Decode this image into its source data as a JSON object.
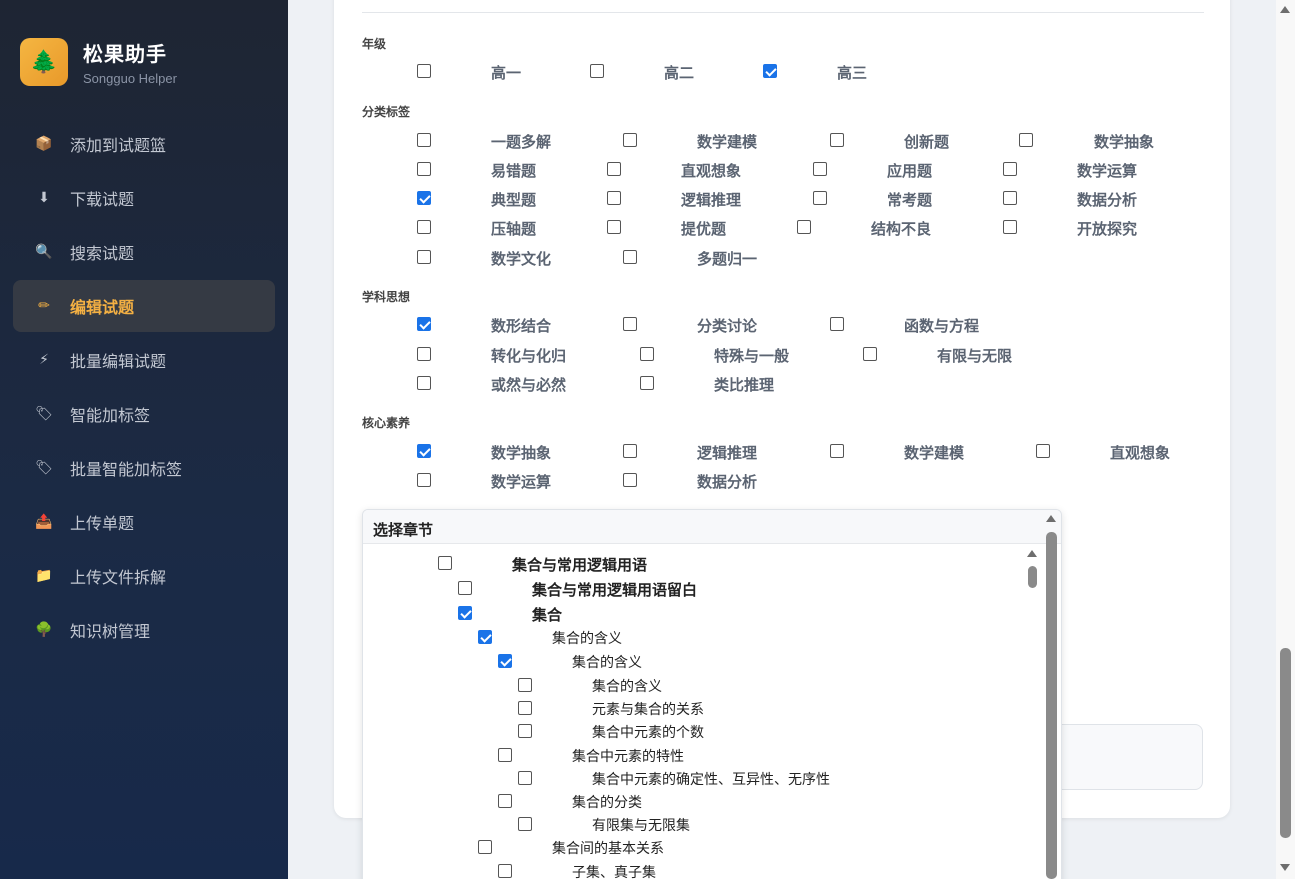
{
  "brand": {
    "title": "松果助手",
    "subtitle": "Songguo Helper",
    "logo_icon": "🌲"
  },
  "nav": [
    {
      "label": "添加到试题篮",
      "icon": "📦"
    },
    {
      "label": "下载试题",
      "icon": "⬇"
    },
    {
      "label": "搜索试题",
      "icon": "🔍"
    },
    {
      "label": "编辑试题",
      "icon": "✏",
      "active": true
    },
    {
      "label": "批量编辑试题",
      "icon": "⚡"
    },
    {
      "label": "智能加标签",
      "icon": "🏷"
    },
    {
      "label": "批量智能加标签",
      "icon": "🏷"
    },
    {
      "label": "上传单题",
      "icon": "📤"
    },
    {
      "label": "上传文件拆解",
      "icon": "📁"
    },
    {
      "label": "知识树管理",
      "icon": "🌳"
    }
  ],
  "sections": {
    "grade": {
      "label": "年级",
      "options": [
        {
          "text": "高一",
          "checked": false
        },
        {
          "text": "高二",
          "checked": false
        },
        {
          "text": "高三",
          "checked": true
        }
      ]
    },
    "category": {
      "label": "分类标签",
      "options": [
        {
          "text": "一题多解",
          "checked": false
        },
        {
          "text": "数学建模",
          "checked": false
        },
        {
          "text": "创新题",
          "checked": false
        },
        {
          "text": "数学抽象",
          "checked": false
        },
        {
          "text": "易错题",
          "checked": false
        },
        {
          "text": "直观想象",
          "checked": false
        },
        {
          "text": "应用题",
          "checked": false
        },
        {
          "text": "数学运算",
          "checked": false
        },
        {
          "text": "典型题",
          "checked": true
        },
        {
          "text": "逻辑推理",
          "checked": false
        },
        {
          "text": "常考题",
          "checked": false
        },
        {
          "text": "数据分析",
          "checked": false
        },
        {
          "text": "压轴题",
          "checked": false
        },
        {
          "text": "提优题",
          "checked": false
        },
        {
          "text": "结构不良",
          "checked": false
        },
        {
          "text": "开放探究",
          "checked": false
        },
        {
          "text": "数学文化",
          "checked": false
        },
        {
          "text": "多题归一",
          "checked": false
        }
      ]
    },
    "thinking": {
      "label": "学科思想",
      "options": [
        {
          "text": "数形结合",
          "checked": true
        },
        {
          "text": "分类讨论",
          "checked": false
        },
        {
          "text": "函数与方程",
          "checked": false
        },
        {
          "text": "转化与化归",
          "checked": false
        },
        {
          "text": "特殊与一般",
          "checked": false
        },
        {
          "text": "有限与无限",
          "checked": false
        },
        {
          "text": "或然与必然",
          "checked": false
        },
        {
          "text": "类比推理",
          "checked": false
        }
      ]
    },
    "literacy": {
      "label": "核心素养",
      "options": [
        {
          "text": "数学抽象",
          "checked": true
        },
        {
          "text": "逻辑推理",
          "checked": false
        },
        {
          "text": "数学建模",
          "checked": false
        },
        {
          "text": "直观想象",
          "checked": false
        },
        {
          "text": "数学运算",
          "checked": false
        },
        {
          "text": "数据分析",
          "checked": false
        }
      ]
    }
  },
  "chapter": {
    "title": "选择章节",
    "tree": [
      {
        "text": "集合与常用逻辑用语",
        "checked": false,
        "level": 0,
        "bold": true
      },
      {
        "text": "集合与常用逻辑用语留白",
        "checked": false,
        "level": 1,
        "bold": true
      },
      {
        "text": "集合",
        "checked": true,
        "level": 1,
        "bold": true
      },
      {
        "text": "集合的含义",
        "checked": true,
        "level": 2,
        "bold": false
      },
      {
        "text": "集合的含义",
        "checked": true,
        "level": 3,
        "bold": false
      },
      {
        "text": "集合的含义",
        "checked": false,
        "level": 4,
        "bold": false
      },
      {
        "text": "元素与集合的关系",
        "checked": false,
        "level": 4,
        "bold": false
      },
      {
        "text": "集合中元素的个数",
        "checked": false,
        "level": 4,
        "bold": false
      },
      {
        "text": "集合中元素的特性",
        "checked": false,
        "level": 3,
        "bold": false
      },
      {
        "text": "集合中元素的确定性、互异性、无序性",
        "checked": false,
        "level": 4,
        "bold": false
      },
      {
        "text": "集合的分类",
        "checked": false,
        "level": 3,
        "bold": false
      },
      {
        "text": "有限集与无限集",
        "checked": false,
        "level": 4,
        "bold": false
      },
      {
        "text": "集合间的基本关系",
        "checked": false,
        "level": 2,
        "bold": false
      },
      {
        "text": "子集、真子集",
        "checked": false,
        "level": 3,
        "bold": false
      }
    ]
  }
}
